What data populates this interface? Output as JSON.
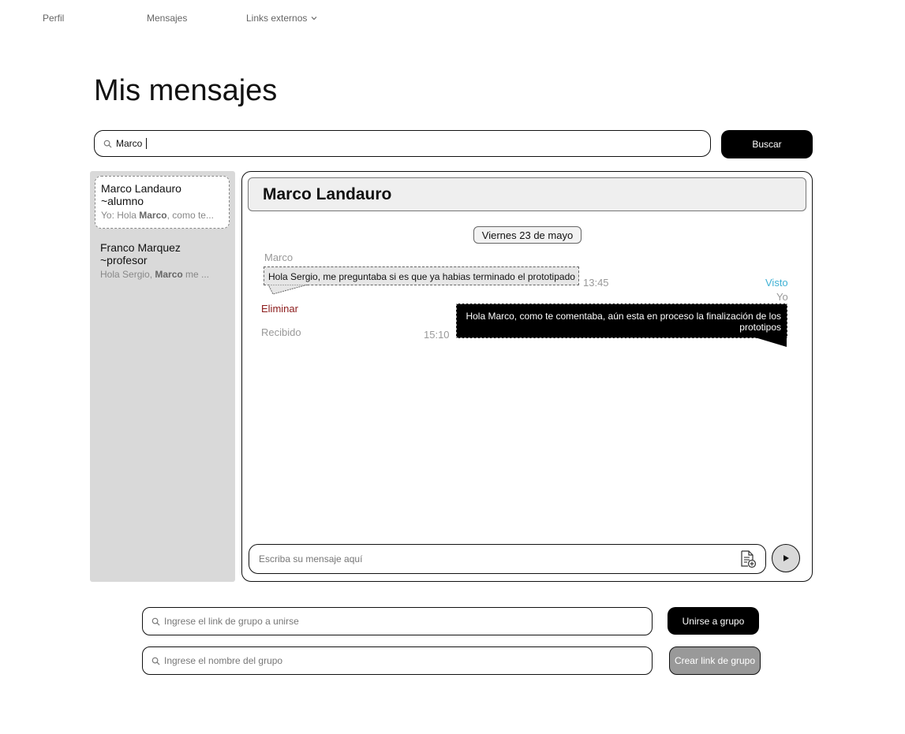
{
  "nav": {
    "perfil": "Perfil",
    "mensajes": "Mensajes",
    "links_externos": "Links externos"
  },
  "page_title": "Mis mensajes",
  "search": {
    "value": "Marco",
    "button": "Buscar"
  },
  "contacts": [
    {
      "name_line1": "Marco Landauro",
      "name_line2": "~alumno",
      "preview_prefix": "Yo: Hola ",
      "preview_highlight": "Marco",
      "preview_suffix": ", como te...",
      "active": true
    },
    {
      "name_line1": "Franco Marquez",
      "name_line2": "~profesor",
      "preview_prefix": "Hola Sergio, ",
      "preview_highlight": "Marco",
      "preview_suffix": " me ...",
      "active": false
    }
  ],
  "chat": {
    "header": "Marco Landauro",
    "date": "Viernes 23 de mayo",
    "incoming": {
      "sender": "Marco",
      "text": "Hola Sergio, me preguntaba si es que ya habias terminado el prototipado",
      "time": "13:45",
      "delete_label": "Eliminar",
      "status": "Recibido"
    },
    "outgoing": {
      "seen": "Visto",
      "sender": "Yo",
      "text": "Hola Marco, como te comentaba, aún esta en proceso la finalización de los prototipos",
      "time": "15:10"
    },
    "input_placeholder": "Escriba su mensaje aquí"
  },
  "groups": {
    "join_placeholder": "Ingrese el link de grupo a unirse",
    "join_button": "Unirse a grupo",
    "name_placeholder": "Ingrese el nombre del grupo",
    "create_button": "Crear link de grupo"
  },
  "colors": {
    "seen": "#3fb1d4",
    "delete": "#8b1a1a",
    "sidebar_bg": "#d9d9d9",
    "primary_button": "#000000",
    "disabled_button": "#999999"
  }
}
